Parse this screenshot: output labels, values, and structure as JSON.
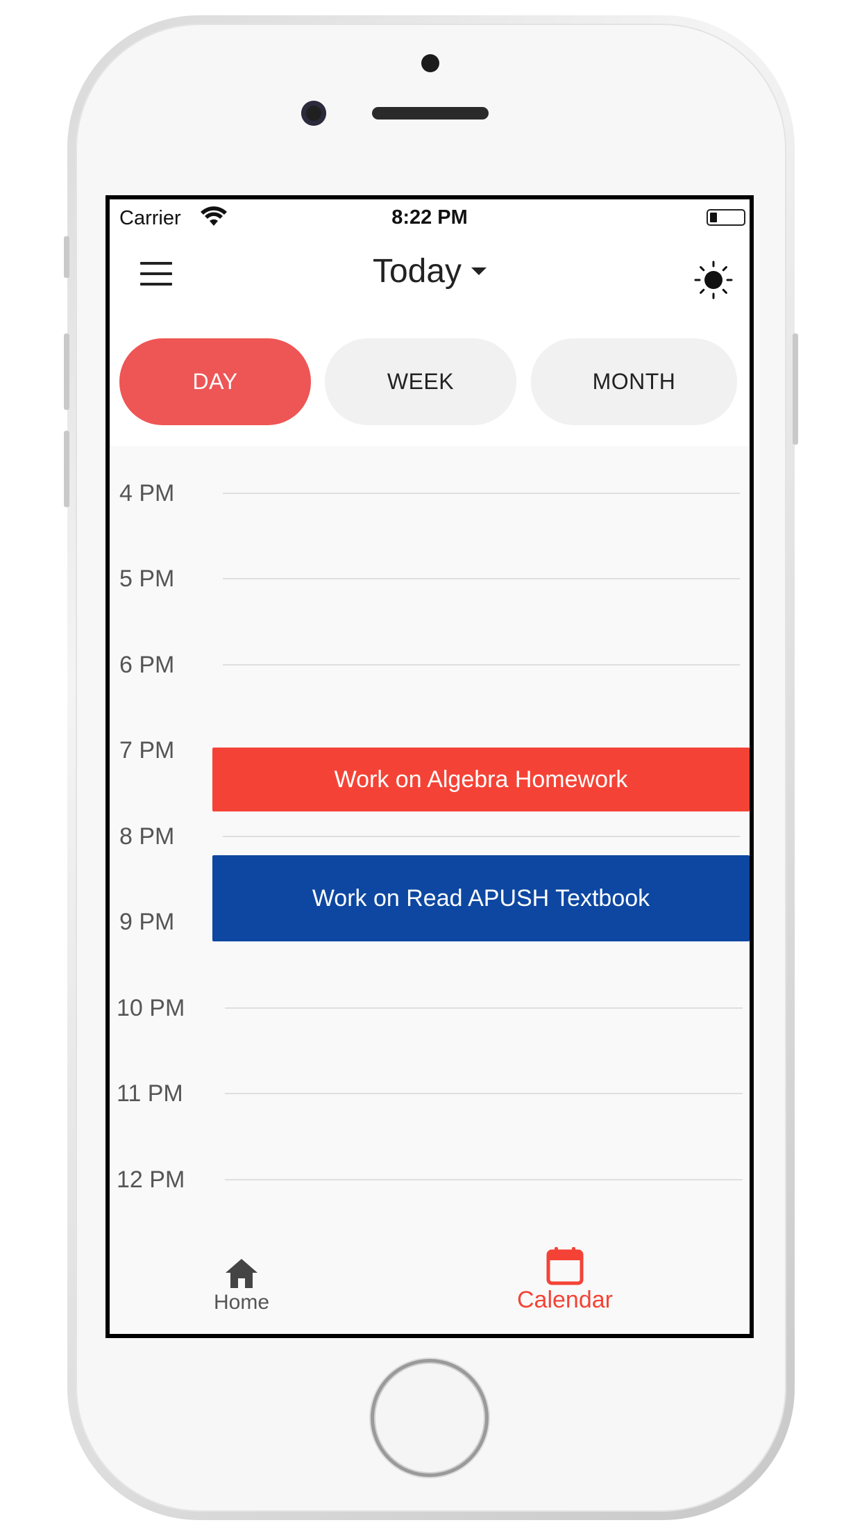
{
  "status_bar": {
    "carrier": "Carrier",
    "time": "8:22 PM",
    "icons": [
      "wifi-icon",
      "battery-icon"
    ]
  },
  "header": {
    "title": "Today",
    "left_icon": "menu-icon",
    "right_icon": "sun-icon",
    "title_icon": "caret-down-icon"
  },
  "tabs": [
    {
      "label": "DAY",
      "active": true
    },
    {
      "label": "WEEK",
      "active": false
    },
    {
      "label": "MONTH",
      "active": false
    }
  ],
  "timeline": {
    "hours": [
      "4 PM",
      "5 PM",
      "6 PM",
      "7 PM",
      "8 PM",
      "9 PM",
      "10 PM",
      "11 PM",
      "12 PM"
    ]
  },
  "events": [
    {
      "title": "Work on Algebra Homework",
      "color": "#f44336"
    },
    {
      "title": "Work on Read APUSH Textbook",
      "color": "#0d47a1"
    }
  ],
  "bottom_nav": [
    {
      "label": "Home",
      "icon": "home-icon",
      "active": false
    },
    {
      "label": "Calendar",
      "icon": "calendar-icon",
      "active": true
    }
  ],
  "colors": {
    "accent": "#ee5555",
    "active_nav": "#f44336",
    "inactive_nav": "#555555"
  }
}
